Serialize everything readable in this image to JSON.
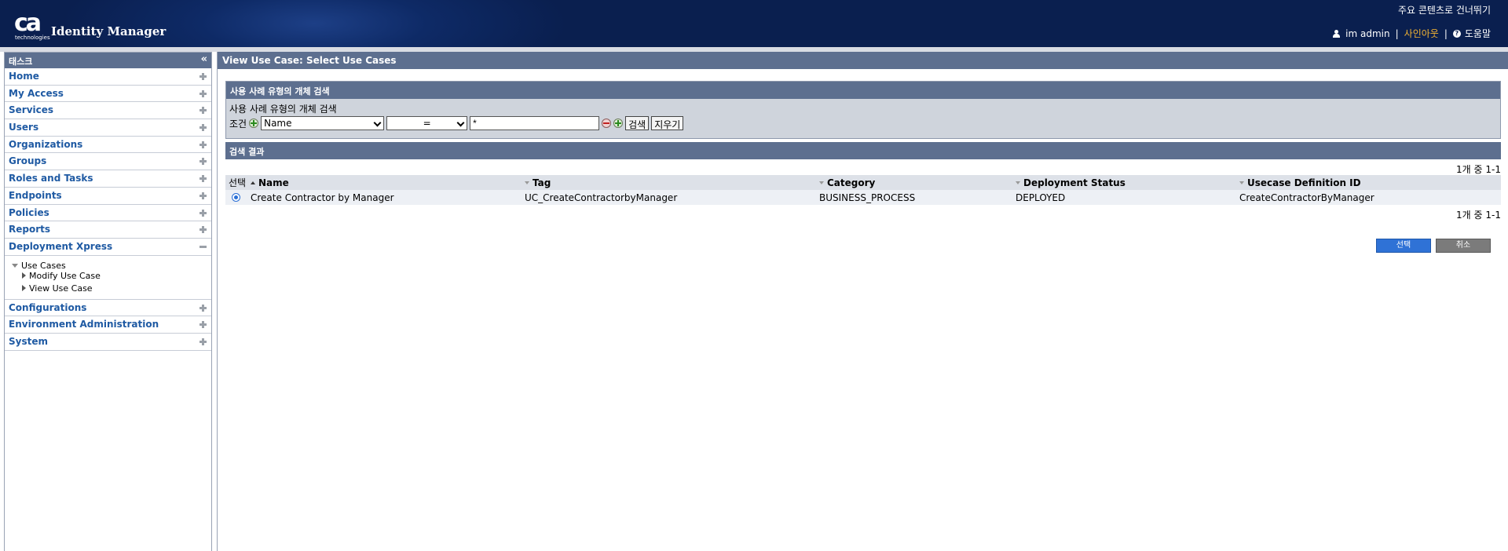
{
  "header": {
    "logo_text": "ca",
    "logo_subtext": "technologies",
    "app_title": "Identity Manager",
    "skip_link": "주요 콘텐츠로 건너뛰기",
    "user": "im admin",
    "signout": "사인아웃",
    "help": "도움말",
    "signout_color": "#f2b333"
  },
  "sidebar": {
    "title": "태스크",
    "items": [
      {
        "label": "Home"
      },
      {
        "label": "My Access"
      },
      {
        "label": "Services"
      },
      {
        "label": "Users"
      },
      {
        "label": "Organizations"
      },
      {
        "label": "Groups"
      },
      {
        "label": "Roles and Tasks"
      },
      {
        "label": "Endpoints"
      },
      {
        "label": "Policies"
      },
      {
        "label": "Reports"
      },
      {
        "label": "Deployment Xpress"
      },
      {
        "label": "Configurations"
      },
      {
        "label": "Environment Administration"
      },
      {
        "label": "System"
      }
    ],
    "subtree": {
      "parent": "Use Cases",
      "children": [
        "Modify Use Case",
        "View Use Case"
      ]
    }
  },
  "main": {
    "page_title": "View Use Case: Select Use Cases",
    "search": {
      "header": "사용 사례 유형의 개체 검색",
      "label": "사용 사례 유형의 개체 검색",
      "condition_label": "조건",
      "field_value": "Name",
      "operator_value": "=",
      "text_value": "*",
      "search_button": "검색",
      "clear_button": "지우기"
    },
    "results": {
      "header": "검색 결과",
      "pager": "1개 중 1-1",
      "columns": {
        "select": "선택",
        "name": "Name",
        "tag": "Tag",
        "category": "Category",
        "status": "Deployment Status",
        "definition_id": "Usecase Definition ID"
      },
      "rows": [
        {
          "name": "Create Contractor by Manager",
          "tag": "UC_CreateContractorbyManager",
          "category": "BUSINESS_PROCESS",
          "status": "DEPLOYED",
          "definition_id": "CreateContractorByManager"
        }
      ]
    },
    "select_button": "선택",
    "cancel_button": "취소"
  },
  "colors": {
    "header_bg": "#0a1f4f",
    "panel_header": "#5d6f8f",
    "nav_link": "#1f5aa3",
    "primary_button": "#2f72d6",
    "secondary_button": "#7b7b7b"
  }
}
